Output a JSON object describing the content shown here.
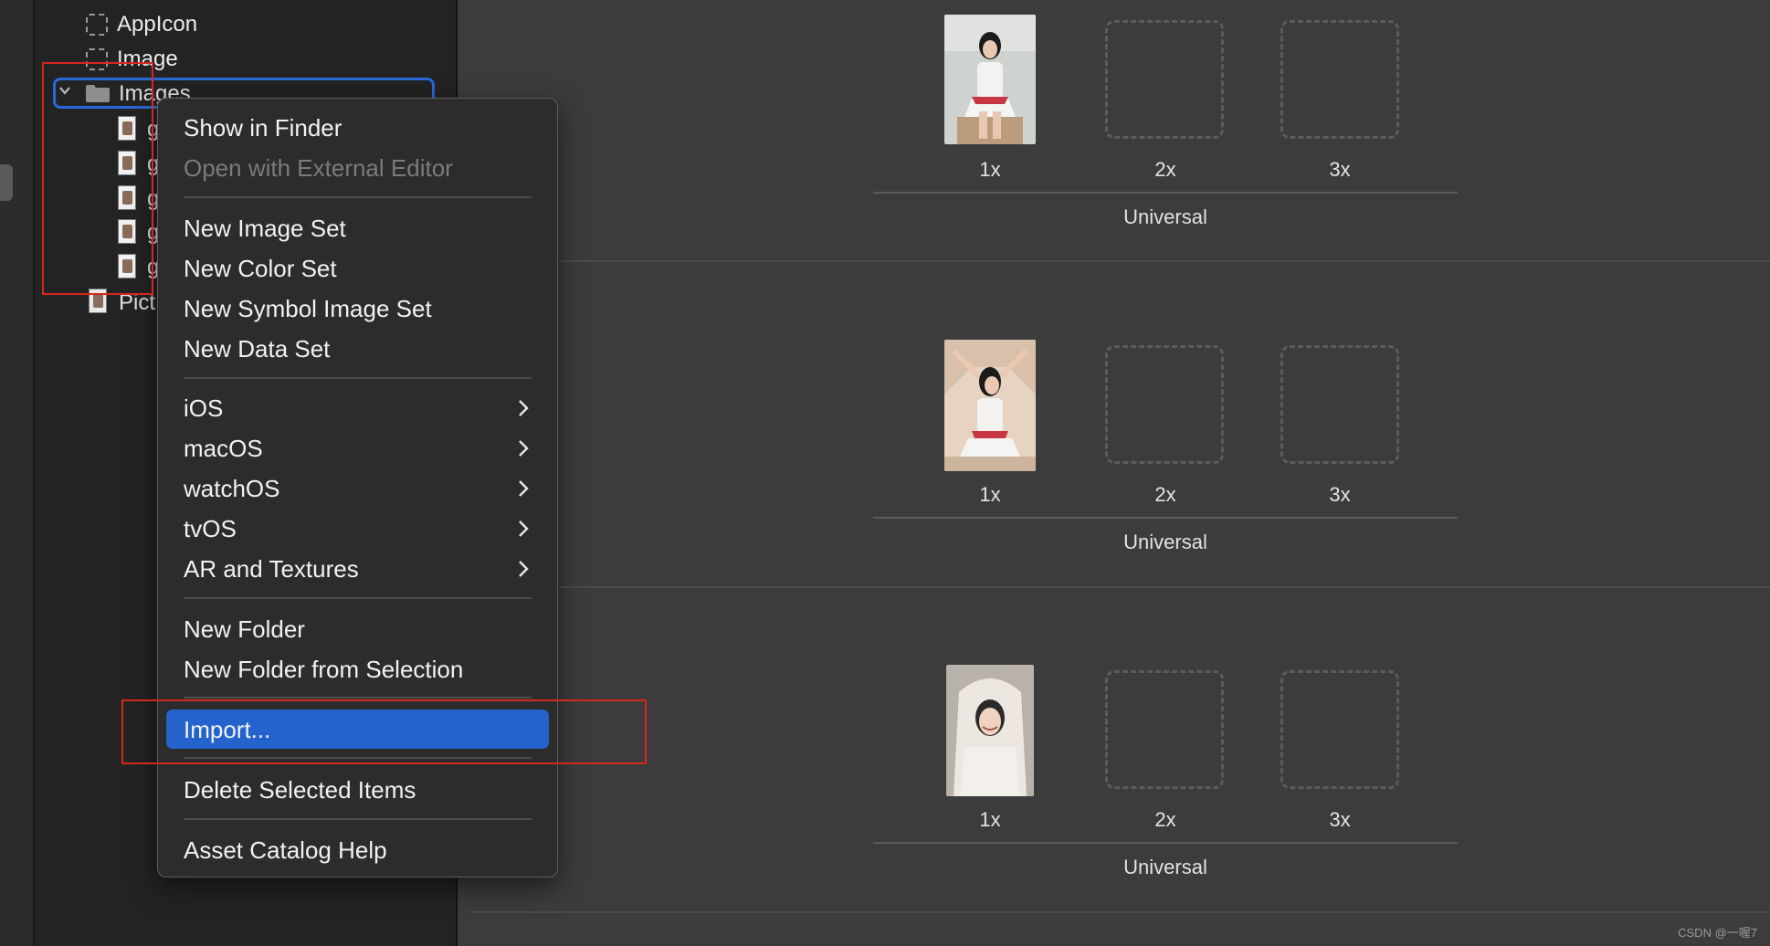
{
  "navigator": {
    "items": [
      {
        "label": "AppIcon"
      },
      {
        "label": "Image"
      },
      {
        "label": "Images"
      }
    ],
    "children_partial": [
      "g",
      "g",
      "g",
      "g",
      "g"
    ],
    "pictures_partial": "Pict"
  },
  "context_menu": {
    "show_in_finder": "Show in Finder",
    "open_external": "Open with External Editor",
    "new_image_set": "New Image Set",
    "new_color_set": "New Color Set",
    "new_symbol_image_set": "New Symbol Image Set",
    "new_data_set": "New Data Set",
    "ios": "iOS",
    "macos": "macOS",
    "watchos": "watchOS",
    "tvos": "tvOS",
    "ar_textures": "AR and Textures",
    "new_folder": "New Folder",
    "new_folder_from_selection": "New Folder from Selection",
    "import": "Import...",
    "delete_selected": "Delete Selected Items",
    "help": "Asset Catalog Help",
    "highlighted_item": "Import..."
  },
  "asset_sets": [
    {
      "scales": [
        "1x",
        "2x",
        "3x"
      ],
      "group": "Universal"
    },
    {
      "scales": [
        "1x",
        "2x",
        "3x"
      ],
      "group": "Universal"
    },
    {
      "scales": [
        "1x",
        "2x",
        "3x"
      ],
      "group": "Universal"
    }
  ],
  "watermark": "CSDN @一喔7",
  "colors": {
    "selection_blue": "#2563cc",
    "annotation_red": "#d7261d",
    "menu_bg": "#2c2c2d"
  }
}
